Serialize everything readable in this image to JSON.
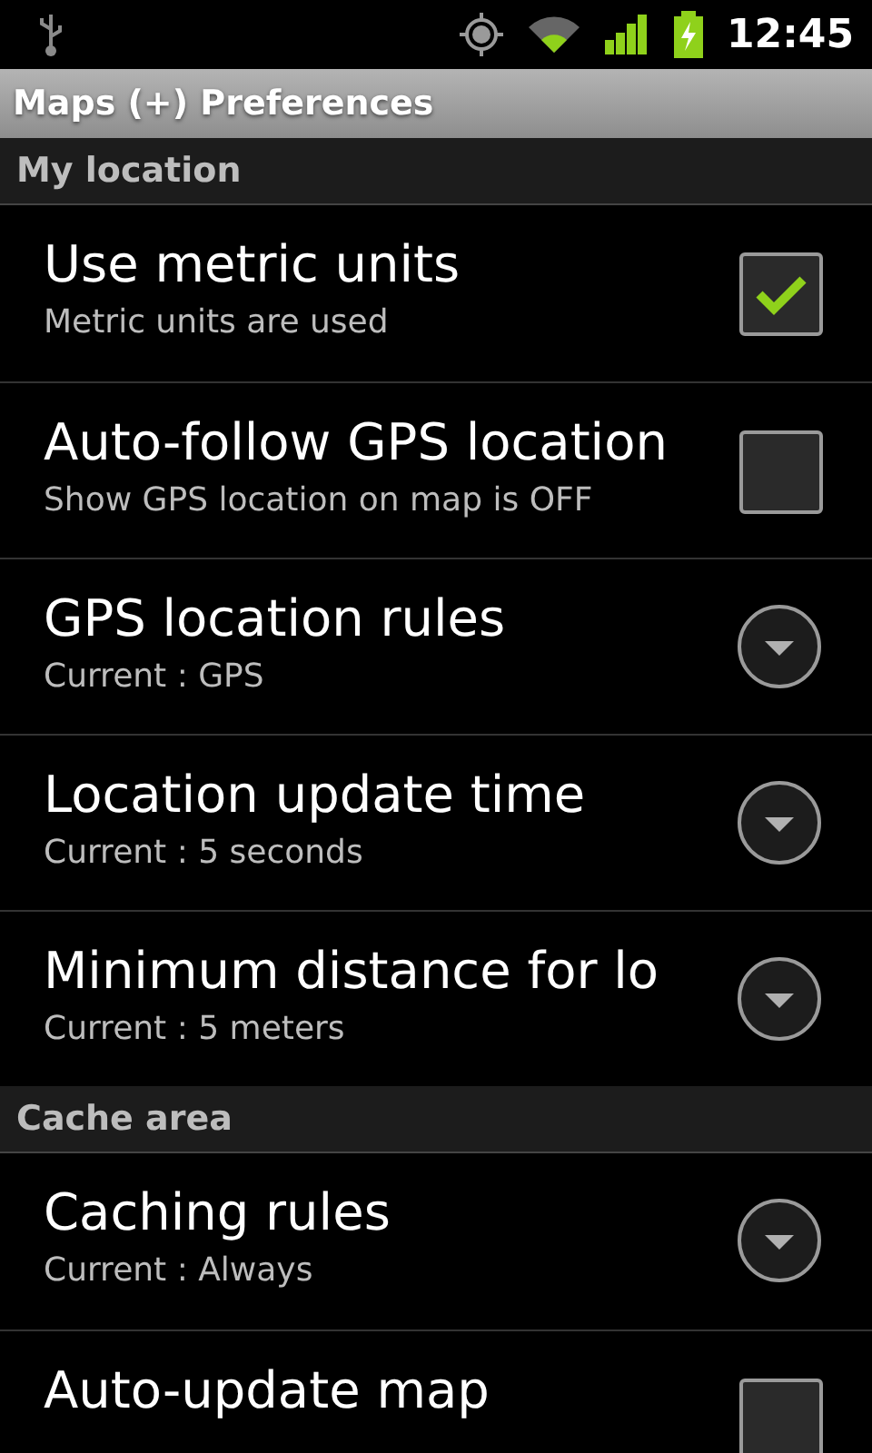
{
  "status_bar": {
    "time": "12:45"
  },
  "title": "Maps (+) Preferences",
  "sections": [
    {
      "header": "My location",
      "items": [
        {
          "kind": "check",
          "title": "Use metric units",
          "summary": "Metric units are used",
          "checked": true
        },
        {
          "kind": "check",
          "title": "Auto-follow GPS location",
          "summary": "Show GPS location on map is OFF",
          "checked": false
        },
        {
          "kind": "list",
          "title": "GPS location rules",
          "summary": "Current : GPS"
        },
        {
          "kind": "list",
          "title": "Location update time",
          "summary": "Current : 5 seconds"
        },
        {
          "kind": "list",
          "title": "Minimum distance for lo",
          "summary": "Current : 5 meters"
        }
      ]
    },
    {
      "header": "Cache area",
      "items": [
        {
          "kind": "list",
          "title": "Caching rules",
          "summary": "Current : Always"
        },
        {
          "kind": "check",
          "title": "Auto-update map",
          "checked": false
        }
      ]
    }
  ]
}
